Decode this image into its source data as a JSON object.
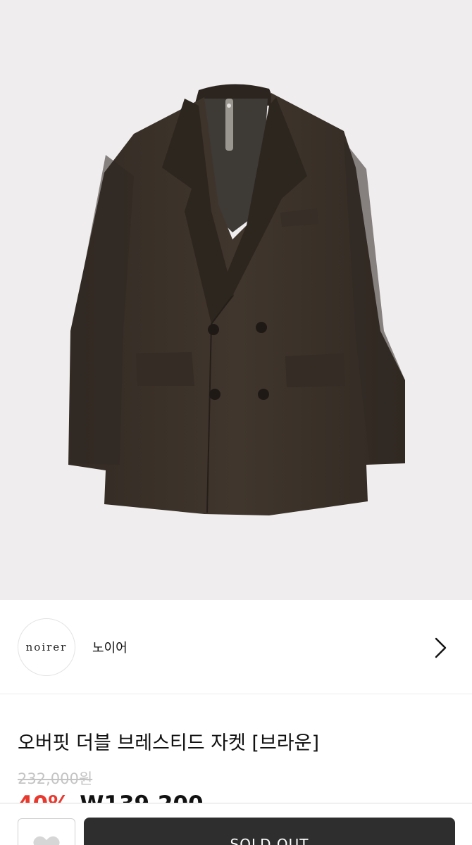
{
  "product": {
    "image_alt": "brown double-breasted jacket",
    "title": "오버핏 더블 브레스티드 자켓 [브라운]",
    "original_price": "232,000원",
    "discount_rate": "40%",
    "sale_price": "W139,200"
  },
  "brand": {
    "logo_text": "noirer",
    "name": "노이어"
  },
  "actions": {
    "soldout_label": "SOLD OUT"
  },
  "icons": {
    "brand_link": "chevron-right-icon",
    "wish": "heart-icon"
  },
  "colors": {
    "image_background": "#efedee",
    "jacket": "#3a322a",
    "discount": "#e8392f",
    "soldout_button": "#2e2e2e"
  }
}
